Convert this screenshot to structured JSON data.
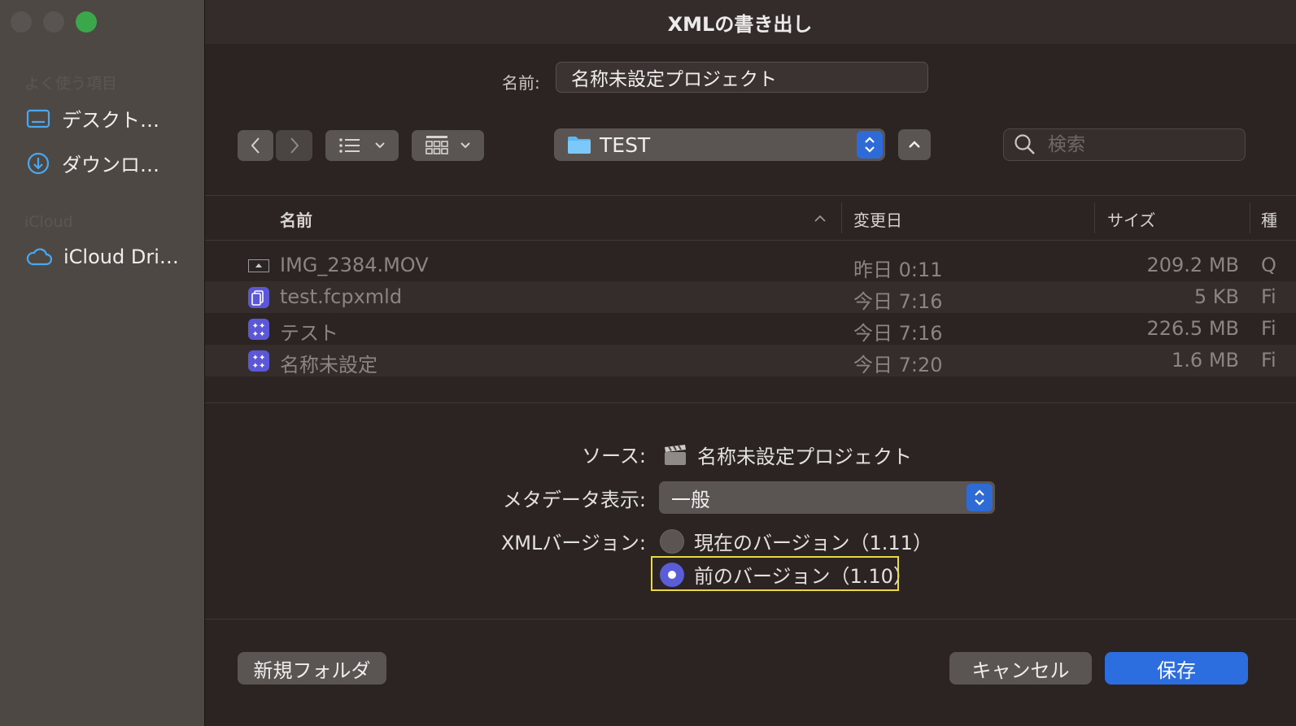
{
  "window": {
    "title": "XMLの書き出し"
  },
  "sidebar": {
    "favorites_header": "よく使う項目",
    "favorites": [
      {
        "label": "デスクト…",
        "icon": "desktop-icon"
      },
      {
        "label": "ダウンロ…",
        "icon": "download-icon"
      }
    ],
    "icloud_header": "iCloud",
    "icloud": [
      {
        "label": "iCloud Dri…",
        "icon": "cloud-icon"
      }
    ]
  },
  "save": {
    "name_label": "名前:",
    "name_value": "名称未設定プロジェクト"
  },
  "toolbar": {
    "folder": "TEST",
    "search_placeholder": "検索"
  },
  "file_list": {
    "columns": [
      "名前",
      "変更日",
      "サイズ",
      "種"
    ],
    "rows": [
      {
        "name": "IMG_2384.MOV",
        "date": "昨日 0:11",
        "size": "209.2 MB",
        "kind": "Q",
        "icon": "movie-file-icon"
      },
      {
        "name": "test.fcpxmld",
        "date": "今日 7:16",
        "size": "5 KB",
        "kind": "Fi",
        "icon": "fcpxml-file-icon"
      },
      {
        "name": "テスト",
        "date": "今日 7:16",
        "size": "226.5 MB",
        "kind": "Fi",
        "icon": "fcp-library-icon"
      },
      {
        "name": "名称未設定",
        "date": "今日 7:20",
        "size": "1.6 MB",
        "kind": "Fi",
        "icon": "fcp-library-icon"
      }
    ]
  },
  "options": {
    "source_label": "ソース:",
    "source_value": "名称未設定プロジェクト",
    "metadata_label": "メタデータ表示:",
    "metadata_value": "一般",
    "version_label": "XMLバージョン:",
    "version_current": "現在のバージョン（1.11）",
    "version_previous": "前のバージョン（1.10）",
    "selected_version": "previous"
  },
  "buttons": {
    "new_folder": "新規フォルダ",
    "cancel": "キャンセル",
    "save": "保存"
  },
  "colors": {
    "accent": "#2c6ee0",
    "radio_selected": "#5a5cd8",
    "highlight": "#e9d94a"
  }
}
